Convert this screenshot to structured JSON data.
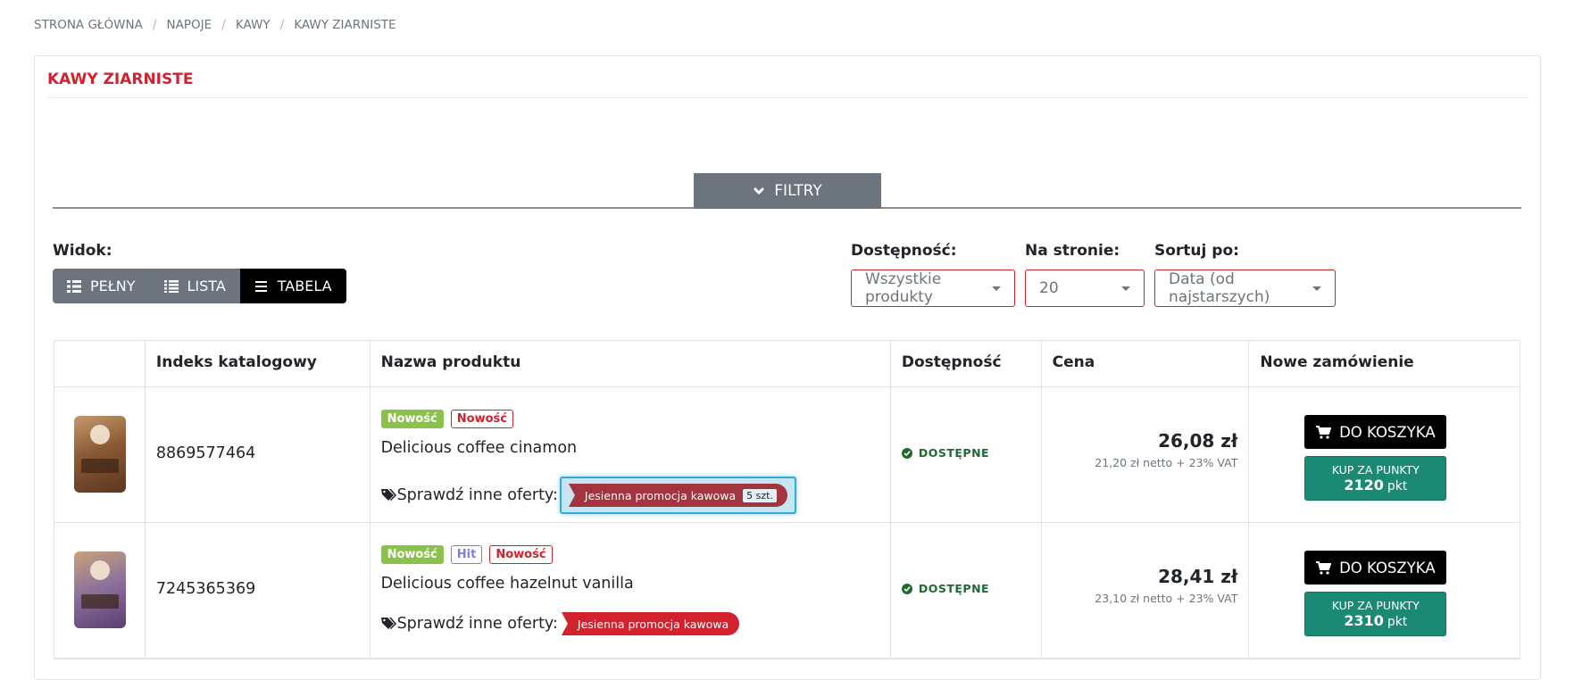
{
  "breadcrumb": [
    "STRONA GŁÓWNA",
    "NAPOJE",
    "KAWY",
    "KAWY ZIARNISTE"
  ],
  "panel": {
    "title": "KAWY ZIARNISTE"
  },
  "filters": {
    "label": "FILTRY"
  },
  "view": {
    "label": "Widok:",
    "buttons": [
      {
        "label": "PEŁNY",
        "icon": "grid-list-icon",
        "active": false
      },
      {
        "label": "LISTA",
        "icon": "list-icon",
        "active": false
      },
      {
        "label": "TABELA",
        "icon": "bars-icon",
        "active": true
      }
    ]
  },
  "availability": {
    "label": "Dostępność:",
    "value": "Wszystkie produkty"
  },
  "per_page": {
    "label": "Na stronie:",
    "value": "20"
  },
  "sort": {
    "label": "Sortuj po:",
    "value": "Data (od najstarszych)"
  },
  "table": {
    "headers": [
      "",
      "Indeks katalogowy",
      "Nazwa produktu",
      "Dostępność",
      "Cena",
      "Nowe zamówienie"
    ],
    "rows": [
      {
        "index": "8869577464",
        "badges": [
          {
            "text": "Nowość",
            "style": "green"
          },
          {
            "text": "Nowość",
            "style": "outline-red"
          }
        ],
        "name": "Delicious coffee cinamon",
        "offers_label": "Sprawdź inne oferty:",
        "promo": "Jesienna promocja kawowa",
        "promo_qty": "5 szt.",
        "availability": "DOSTĘPNE",
        "price": "26,08 zł",
        "net": "21,20 zł netto + 23% VAT",
        "cart_label": "DO KOSZYKA",
        "points_label": "KUP ZA PUNKTY",
        "points": "2120",
        "points_unit": "pkt"
      },
      {
        "index": "7245365369",
        "badges": [
          {
            "text": "Nowość",
            "style": "green"
          },
          {
            "text": "Hit",
            "style": "outline-blue"
          },
          {
            "text": "Nowość",
            "style": "outline-red"
          }
        ],
        "name": "Delicious coffee hazelnut vanilla",
        "offers_label": "Sprawdź inne oferty:",
        "promo": "Jesienna promocja kawowa",
        "availability": "DOSTĘPNE",
        "price": "28,41 zł",
        "net": "23,10 zł netto + 23% VAT",
        "cart_label": "DO KOSZYKA",
        "points_label": "KUP ZA PUNKTY",
        "points": "2310",
        "points_unit": "pkt"
      }
    ]
  },
  "colors": {
    "accent": "#d1222e",
    "points_button": "#1a8a74",
    "available": "#1f6b2f",
    "focus_ring": "#2eaadc"
  }
}
